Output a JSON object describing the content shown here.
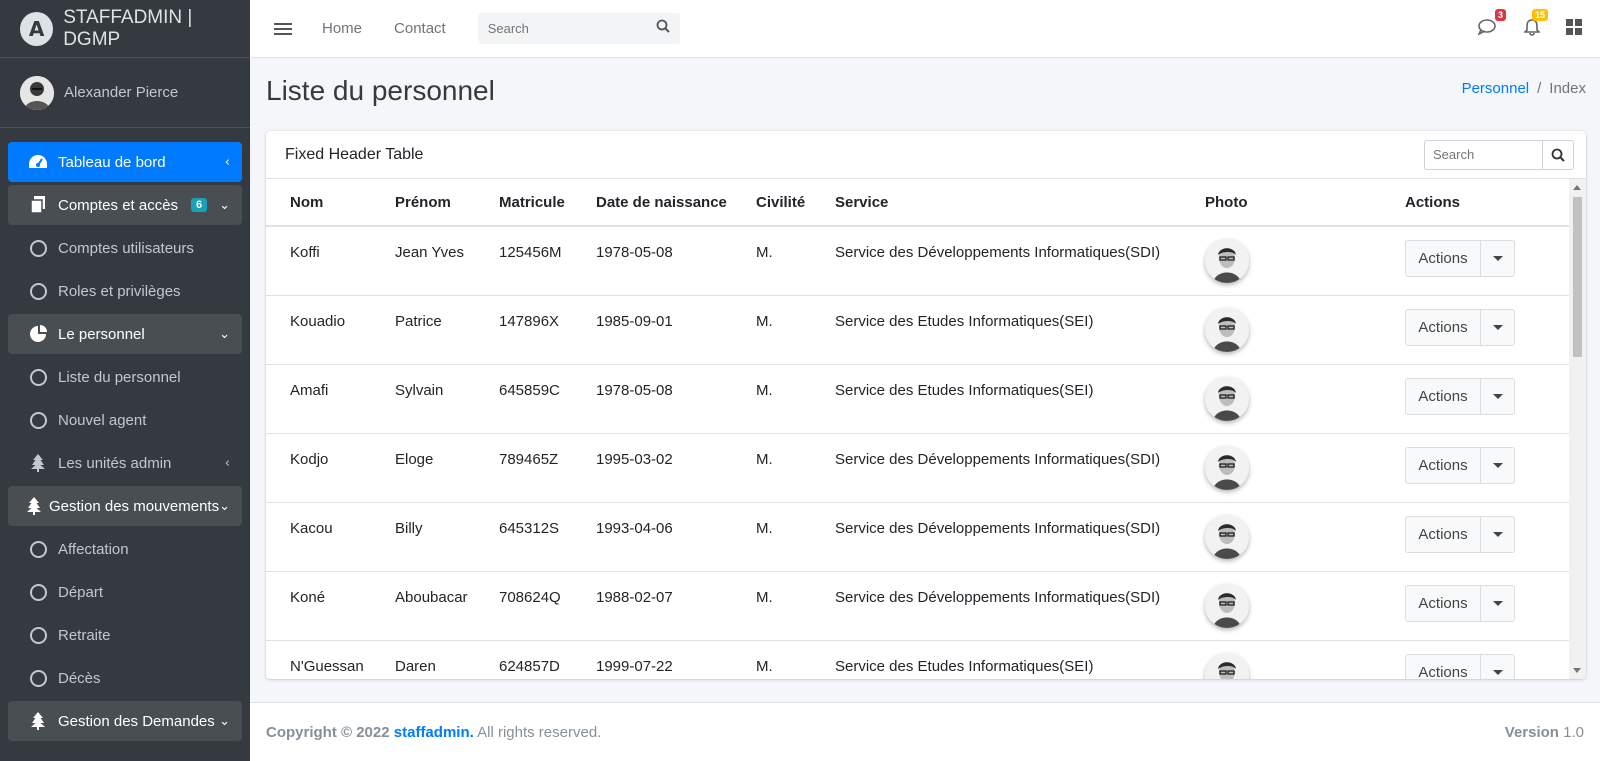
{
  "brand": {
    "name": "STAFFADMIN | DGMP"
  },
  "user": {
    "name": "Alexander Pierce"
  },
  "sidebar": {
    "items": [
      {
        "label": "Tableau de bord"
      },
      {
        "label": "Comptes et accès",
        "badge": "6"
      },
      {
        "label": "Comptes utilisateurs"
      },
      {
        "label": "Roles et privilèges"
      },
      {
        "label": "Le personnel"
      },
      {
        "label": "Liste du personnel"
      },
      {
        "label": "Nouvel agent"
      },
      {
        "label": "Les unités admin"
      },
      {
        "label": "Gestion des mouvements"
      },
      {
        "label": "Affectation"
      },
      {
        "label": "Départ"
      },
      {
        "label": "Retraite"
      },
      {
        "label": "Décès"
      },
      {
        "label": "Gestion des Demandes"
      }
    ]
  },
  "topbar": {
    "links": [
      "Home",
      "Contact"
    ],
    "search_placeholder": "Search",
    "messages_count": "3",
    "notifications_count": "15"
  },
  "page": {
    "title": "Liste du personnel",
    "breadcrumb": {
      "link": "Personnel",
      "separator": "/",
      "current": "Index"
    }
  },
  "card": {
    "title": "Fixed Header Table",
    "search_placeholder": "Search"
  },
  "table": {
    "headers": [
      "Nom",
      "Prénom",
      "Matricule",
      "Date de naissance",
      "Civilité",
      "Service",
      "Photo",
      "Actions"
    ],
    "action_label": "Actions",
    "rows": [
      {
        "nom": "Koffi",
        "prenom": "Jean Yves",
        "matricule": "125456M",
        "naissance": "1978-05-08",
        "civilite": "M.",
        "service": "Service des Développements Informatiques(SDI)"
      },
      {
        "nom": "Kouadio",
        "prenom": "Patrice",
        "matricule": "147896X",
        "naissance": "1985-09-01",
        "civilite": "M.",
        "service": "Service des Etudes Informatiques(SEI)"
      },
      {
        "nom": "Amafi",
        "prenom": "Sylvain",
        "matricule": "645859C",
        "naissance": "1978-05-08",
        "civilite": "M.",
        "service": "Service des Etudes Informatiques(SEI)"
      },
      {
        "nom": "Kodjo",
        "prenom": "Eloge",
        "matricule": "789465Z",
        "naissance": "1995-03-02",
        "civilite": "M.",
        "service": "Service des Développements Informatiques(SDI)"
      },
      {
        "nom": "Kacou",
        "prenom": "Billy",
        "matricule": "645312S",
        "naissance": "1993-04-06",
        "civilite": "M.",
        "service": "Service des Développements Informatiques(SDI)"
      },
      {
        "nom": "Koné",
        "prenom": "Aboubacar",
        "matricule": "708624Q",
        "naissance": "1988-02-07",
        "civilite": "M.",
        "service": "Service des Développements Informatiques(SDI)"
      },
      {
        "nom": "N'Guessan",
        "prenom": "Daren",
        "matricule": "624857D",
        "naissance": "1999-07-22",
        "civilite": "M.",
        "service": "Service des Etudes Informatiques(SEI)"
      }
    ]
  },
  "footer": {
    "copyright": "Copyright © 2022",
    "brand": "staffadmin.",
    "rights": "All rights reserved.",
    "version_label": "Version",
    "version_value": "1.0"
  },
  "colors": {
    "sidebar": "#343a40",
    "primary": "#007bff",
    "badge_info": "#17a2b8",
    "badge_danger": "#dc3545",
    "badge_warning": "#ffc107"
  }
}
